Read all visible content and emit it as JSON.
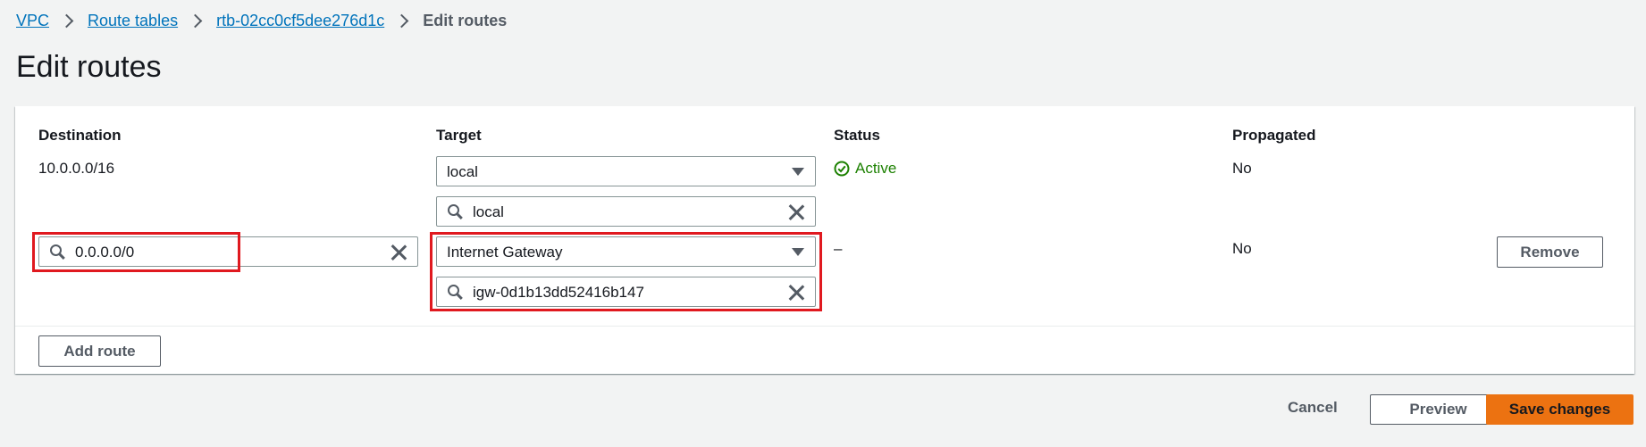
{
  "breadcrumb": {
    "vpc": "VPC",
    "route_tables": "Route tables",
    "rtb": "rtb-02cc0cf5dee276d1c",
    "current": "Edit routes"
  },
  "page_title": "Edit routes",
  "columns": {
    "destination": "Destination",
    "target": "Target",
    "status": "Status",
    "propagated": "Propagated"
  },
  "routes": [
    {
      "destination": "10.0.0.0/16",
      "target_type": "local",
      "target_search": "local",
      "status": "Active",
      "propagated": "No"
    },
    {
      "destination": "0.0.0.0/0",
      "target_type": "Internet Gateway",
      "target_search": "igw-0d1b13dd52416b147",
      "status": "–",
      "propagated": "No",
      "remove_label": "Remove"
    }
  ],
  "add_route_label": "Add route",
  "footer": {
    "cancel": "Cancel",
    "preview": "Preview",
    "save": "Save changes"
  },
  "colors": {
    "link": "#0073bb",
    "active_status": "#1d8102",
    "primary_button": "#ec7211",
    "highlight_box": "#e0191f"
  }
}
